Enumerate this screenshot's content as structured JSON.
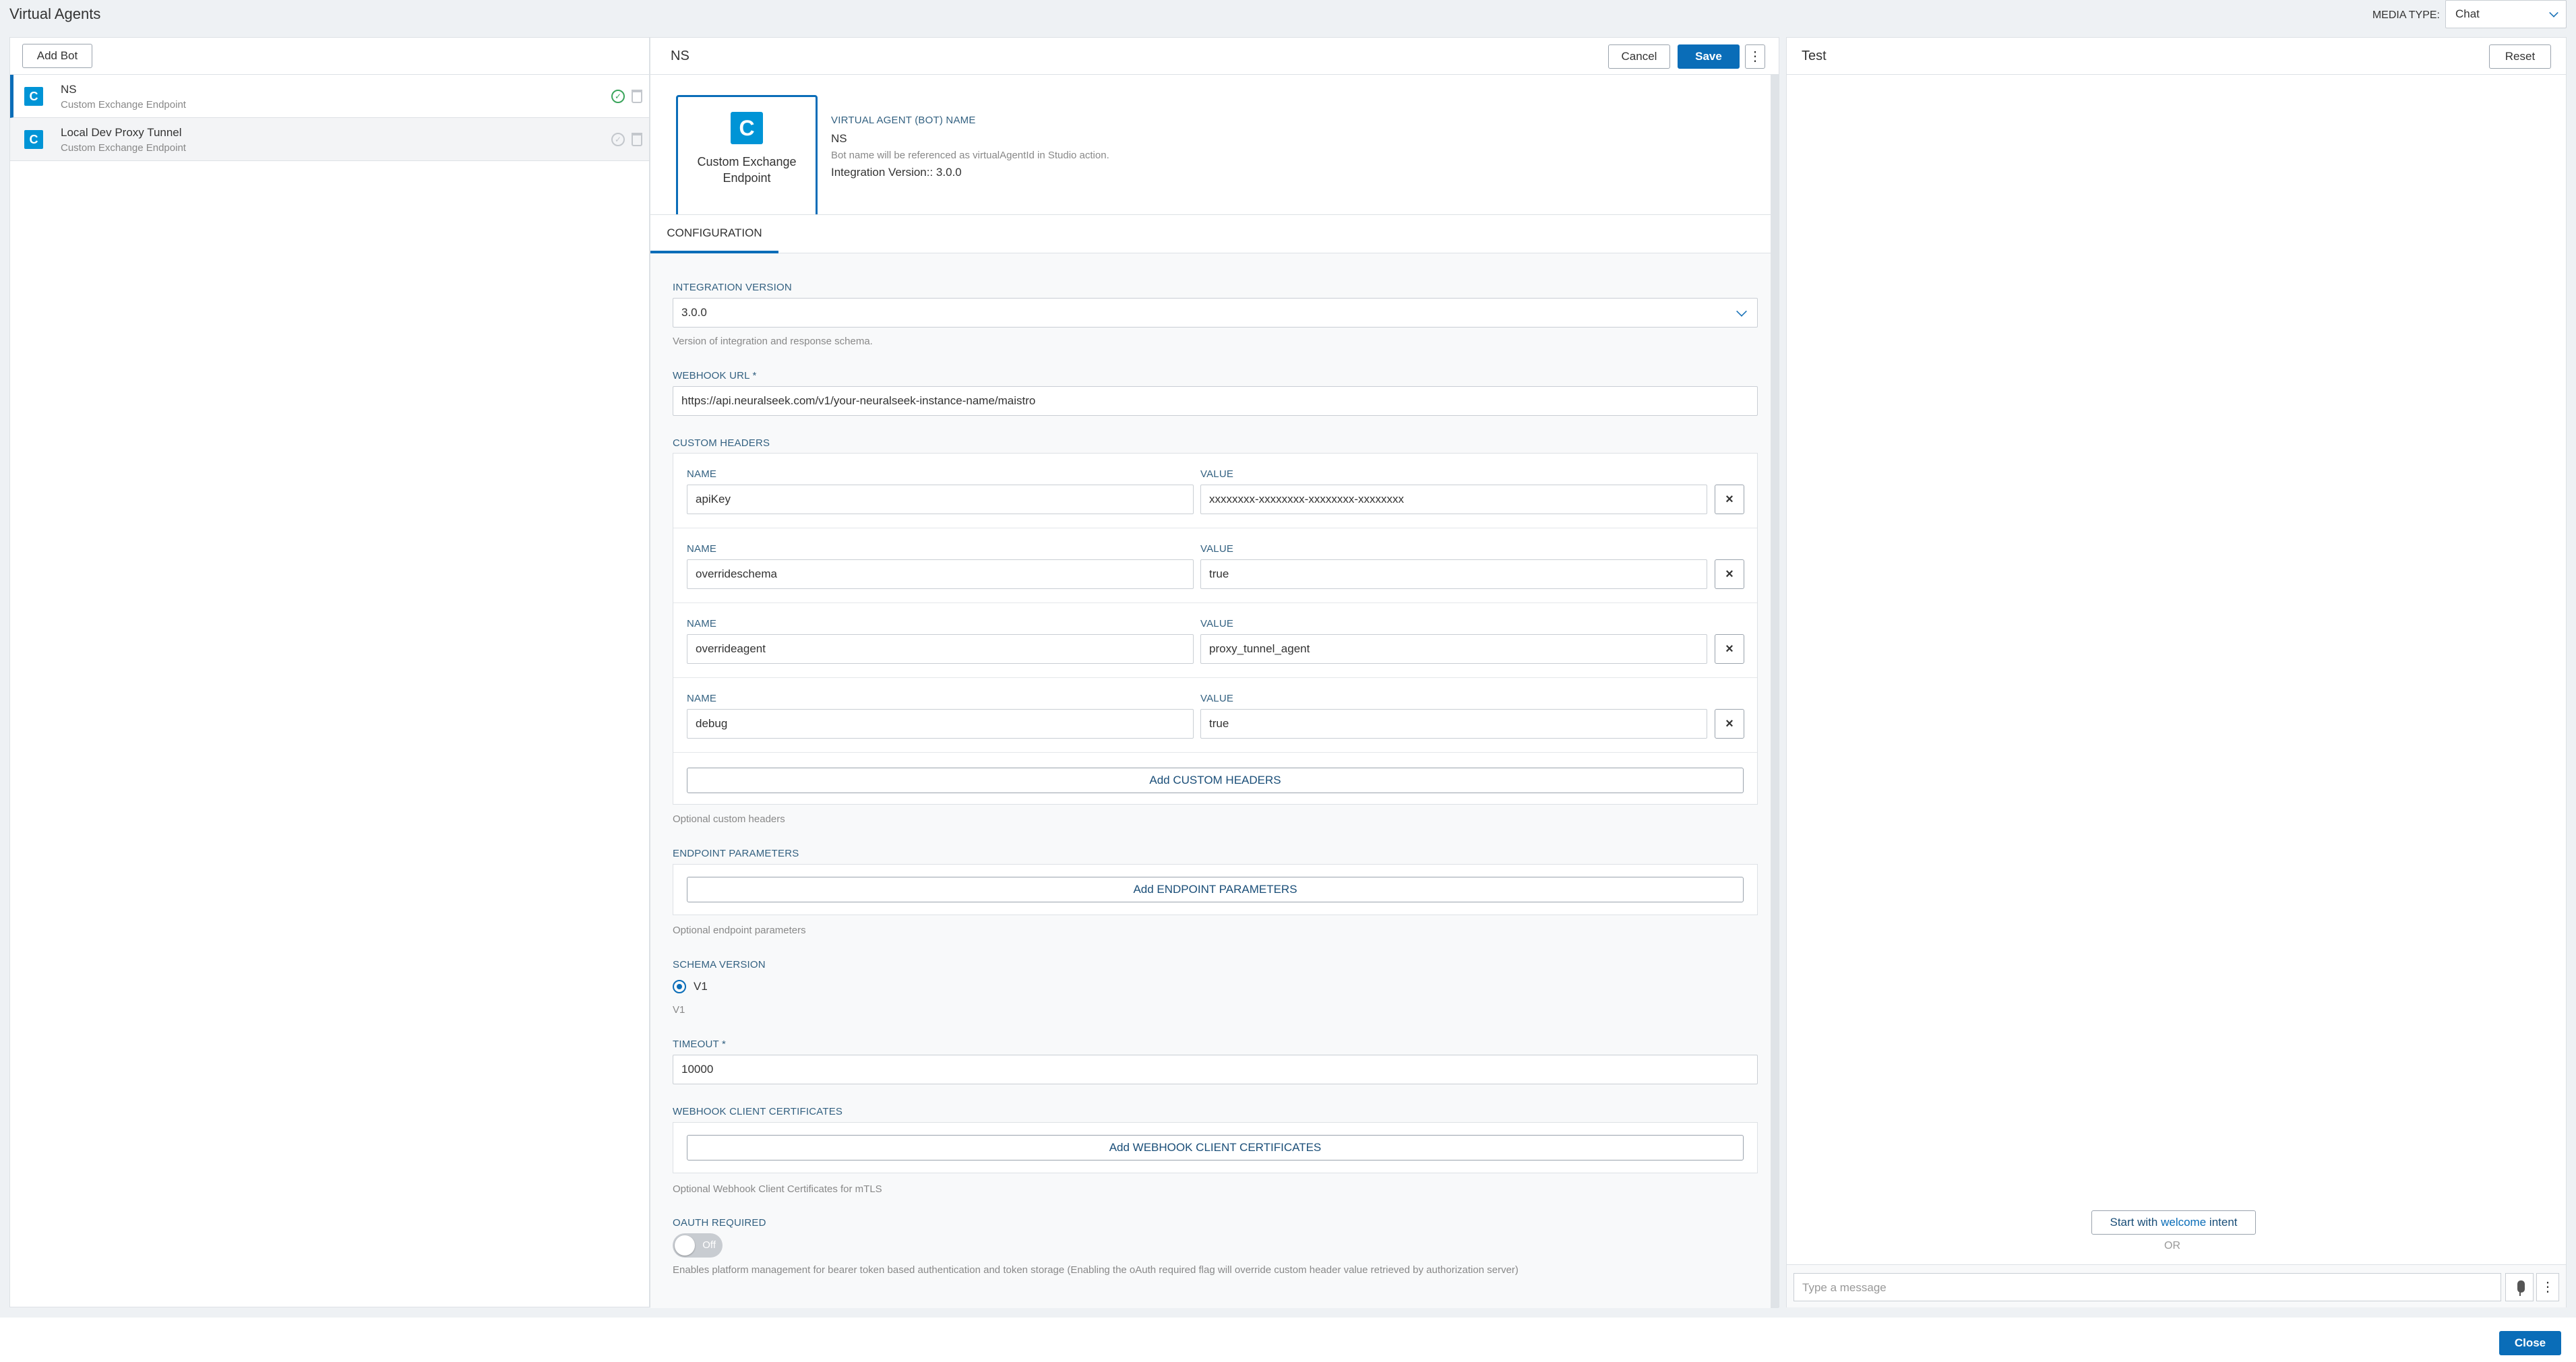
{
  "app": {
    "title": "Virtual Agents"
  },
  "media": {
    "label": "MEDIA TYPE:",
    "value": "Chat"
  },
  "left": {
    "add_bot": "Add Bot",
    "bots": [
      {
        "name": "NS",
        "type": "Custom Exchange Endpoint"
      },
      {
        "name": "Local Dev Proxy Tunnel",
        "type": "Custom Exchange Endpoint"
      }
    ]
  },
  "mid": {
    "title": "NS",
    "cancel": "Cancel",
    "save": "Save",
    "kebab": "⋮",
    "card": {
      "logo": "C",
      "label_line1": "Custom Exchange",
      "label_line2": "Endpoint"
    },
    "bot_name_label": "VIRTUAL AGENT (BOT) NAME",
    "bot_name": "NS",
    "bot_name_help": "Bot name will be referenced as virtualAgentId in Studio action.",
    "integration_version_text": "Integration Version:: 3.0.0",
    "tab": "CONFIGURATION",
    "integration_version": {
      "label": "INTEGRATION VERSION",
      "value": "3.0.0",
      "help": "Version of integration and response schema."
    },
    "webhook": {
      "label": "WEBHOOK URL *",
      "value": "https://api.neuralseek.com/v1/your-neuralseek-instance-name/maistro"
    },
    "custom_headers": {
      "label": "CUSTOM HEADERS",
      "name_label": "NAME",
      "value_label": "VALUE",
      "rows": [
        {
          "name": "apiKey",
          "value": "xxxxxxxx-xxxxxxxx-xxxxxxxx-xxxxxxxx"
        },
        {
          "name": "overrideschema",
          "value": "true"
        },
        {
          "name": "overrideagent",
          "value": "proxy_tunnel_agent"
        },
        {
          "name": "debug",
          "value": "true"
        }
      ],
      "add": "Add CUSTOM HEADERS",
      "help": "Optional custom headers"
    },
    "endpoint_params": {
      "label": "ENDPOINT PARAMETERS",
      "add": "Add ENDPOINT PARAMETERS",
      "help": "Optional endpoint parameters"
    },
    "schema": {
      "label": "SCHEMA VERSION",
      "option": "V1",
      "help": "V1"
    },
    "timeout": {
      "label": "TIMEOUT *",
      "value": "10000"
    },
    "certs": {
      "label": "WEBHOOK CLIENT CERTIFICATES",
      "add": "Add WEBHOOK CLIENT CERTIFICATES",
      "help": "Optional Webhook Client Certificates for mTLS"
    },
    "oauth": {
      "label": "OAUTH REQUIRED",
      "toggle": "Off",
      "help": "Enables platform management for bearer token based authentication and token storage (Enabling the oAuth required flag will override custom header value retrieved by authorization server)"
    }
  },
  "right": {
    "title": "Test",
    "reset": "Reset",
    "welcome_prefix": "Start with ",
    "welcome_word": "welcome",
    "welcome_suffix": " intent",
    "or": "OR",
    "placeholder": "Type a message"
  },
  "footer": {
    "close": "Close"
  }
}
